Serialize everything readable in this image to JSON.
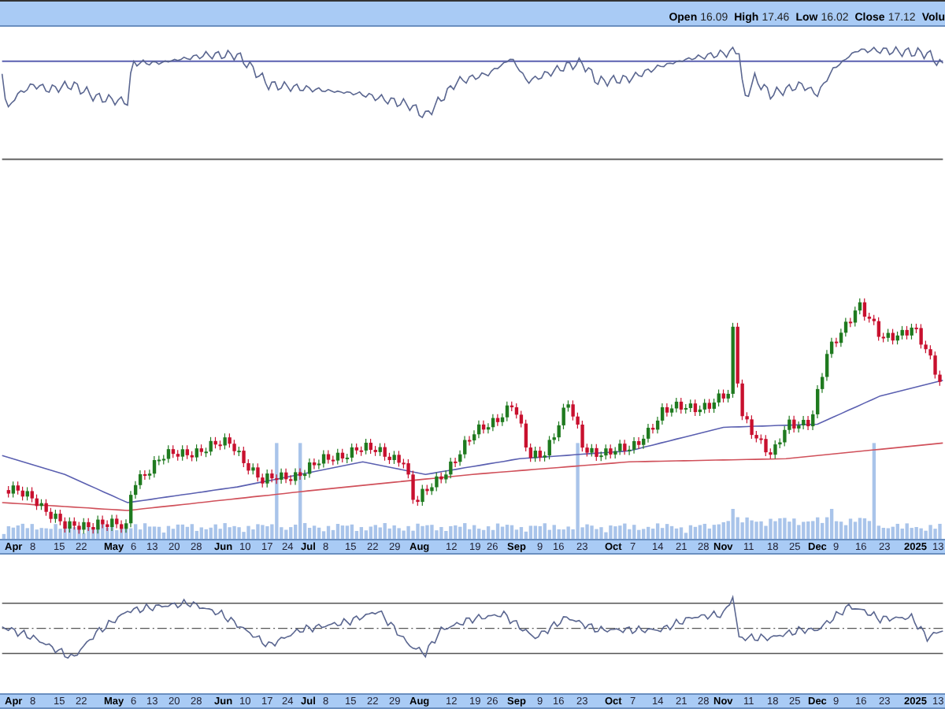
{
  "header": {
    "quote": [
      {
        "label": "Open",
        "value": "16.09"
      },
      {
        "label": "High",
        "value": "17.46"
      },
      {
        "label": "Low",
        "value": "16.02"
      },
      {
        "label": "Close",
        "value": "17.12"
      },
      {
        "label": "Volu"
      }
    ]
  },
  "price_axis": [
    {
      "text": "Apr",
      "kind": "month"
    },
    {
      "text": "8",
      "kind": "day"
    },
    {
      "text": "15",
      "kind": "day"
    },
    {
      "text": "22",
      "kind": "day"
    },
    {
      "text": "May",
      "kind": "month"
    },
    {
      "text": "6",
      "kind": "day"
    },
    {
      "text": "13",
      "kind": "day"
    },
    {
      "text": "20",
      "kind": "day"
    },
    {
      "text": "28",
      "kind": "day"
    },
    {
      "text": "Jun",
      "kind": "month"
    },
    {
      "text": "10",
      "kind": "day"
    },
    {
      "text": "17",
      "kind": "day"
    },
    {
      "text": "24",
      "kind": "day"
    },
    {
      "text": "Jul",
      "kind": "month"
    },
    {
      "text": "8",
      "kind": "day"
    },
    {
      "text": "15",
      "kind": "day"
    },
    {
      "text": "22",
      "kind": "day"
    },
    {
      "text": "29",
      "kind": "day"
    },
    {
      "text": "Aug",
      "kind": "month"
    },
    {
      "text": "12",
      "kind": "day"
    },
    {
      "text": "19",
      "kind": "day"
    },
    {
      "text": "26",
      "kind": "day"
    },
    {
      "text": "Sep",
      "kind": "month"
    },
    {
      "text": "9",
      "kind": "day"
    },
    {
      "text": "16",
      "kind": "day"
    },
    {
      "text": "23",
      "kind": "day"
    },
    {
      "text": "Oct",
      "kind": "month"
    },
    {
      "text": "7",
      "kind": "day"
    },
    {
      "text": "14",
      "kind": "day"
    },
    {
      "text": "21",
      "kind": "day"
    },
    {
      "text": "28",
      "kind": "day"
    },
    {
      "text": "Nov",
      "kind": "month"
    },
    {
      "text": "11",
      "kind": "day"
    },
    {
      "text": "18",
      "kind": "day"
    },
    {
      "text": "25",
      "kind": "day"
    },
    {
      "text": "Dec",
      "kind": "month"
    },
    {
      "text": "9",
      "kind": "day"
    },
    {
      "text": "16",
      "kind": "day"
    },
    {
      "text": "23",
      "kind": "day"
    },
    {
      "text": "2025",
      "kind": "month"
    },
    {
      "text": "13",
      "kind": "day"
    }
  ],
  "indicator_axis": [
    {
      "text": "Apr",
      "kind": "month"
    },
    {
      "text": "8",
      "kind": "day"
    },
    {
      "text": "15",
      "kind": "day"
    },
    {
      "text": "22",
      "kind": "day"
    },
    {
      "text": "May",
      "kind": "month"
    },
    {
      "text": "6",
      "kind": "day"
    },
    {
      "text": "13",
      "kind": "day"
    },
    {
      "text": "20",
      "kind": "day"
    },
    {
      "text": "28",
      "kind": "day"
    },
    {
      "text": "Jun",
      "kind": "month"
    },
    {
      "text": "10",
      "kind": "day"
    },
    {
      "text": "17",
      "kind": "day"
    },
    {
      "text": "24",
      "kind": "day"
    },
    {
      "text": "Jul",
      "kind": "month"
    },
    {
      "text": "8",
      "kind": "day"
    },
    {
      "text": "15",
      "kind": "day"
    },
    {
      "text": "22",
      "kind": "day"
    },
    {
      "text": "29",
      "kind": "day"
    },
    {
      "text": "Aug",
      "kind": "month"
    },
    {
      "text": "12",
      "kind": "day"
    },
    {
      "text": "19",
      "kind": "day"
    },
    {
      "text": "26",
      "kind": "day"
    },
    {
      "text": "Sep",
      "kind": "month"
    },
    {
      "text": "9",
      "kind": "day"
    },
    {
      "text": "16",
      "kind": "day"
    },
    {
      "text": "23",
      "kind": "day"
    },
    {
      "text": "Oct",
      "kind": "month"
    },
    {
      "text": "7",
      "kind": "day"
    },
    {
      "text": "14",
      "kind": "day"
    },
    {
      "text": "21",
      "kind": "day"
    },
    {
      "text": "28",
      "kind": "day"
    },
    {
      "text": "Nov",
      "kind": "month"
    },
    {
      "text": "11",
      "kind": "day"
    },
    {
      "text": "18",
      "kind": "day"
    },
    {
      "text": "25",
      "kind": "day"
    },
    {
      "text": "Dec",
      "kind": "month"
    },
    {
      "text": "9",
      "kind": "day"
    },
    {
      "text": "16",
      "kind": "day"
    },
    {
      "text": "23",
      "kind": "day"
    },
    {
      "text": "2025",
      "kind": "month"
    },
    {
      "text": "13",
      "kind": "day"
    }
  ]
}
